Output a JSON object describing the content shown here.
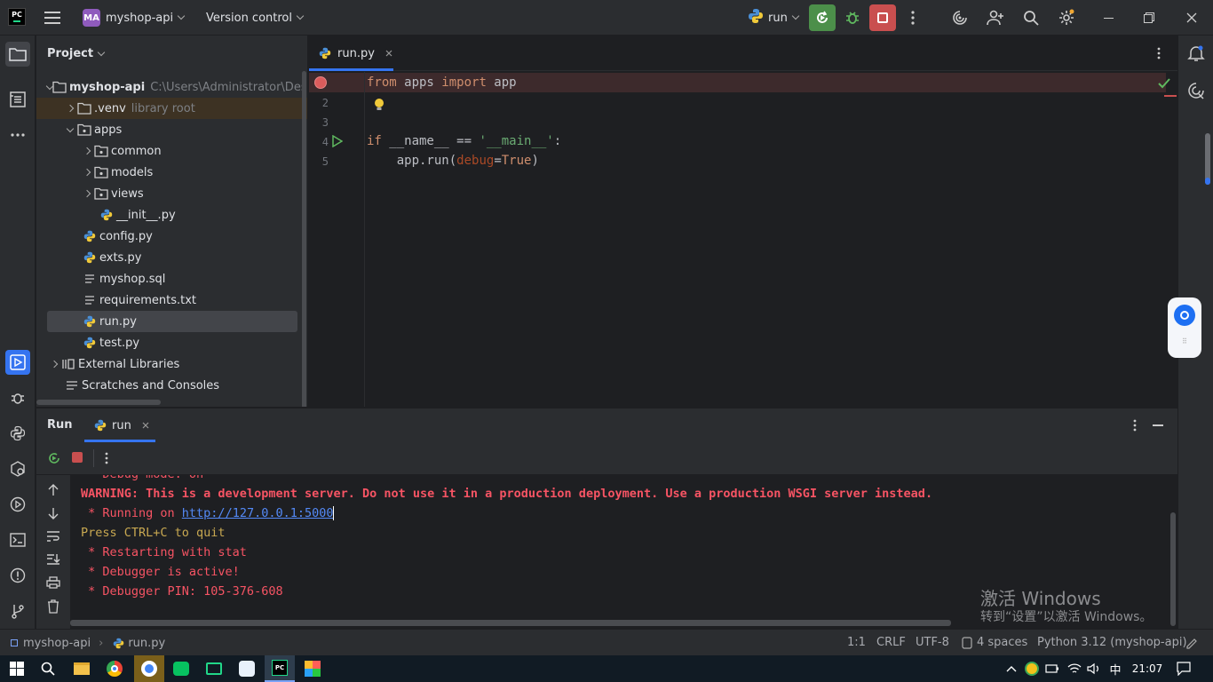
{
  "titlebar": {
    "project_badge": "MA",
    "project_name": "myshop-api",
    "vcs_label": "Version control",
    "run_config": "run"
  },
  "project_panel": {
    "title": "Project",
    "tree": [
      {
        "label": "myshop-api",
        "extra": "C:\\Users\\Administrator\\Deskto"
      },
      {
        "label": ".venv",
        "extra": "library root"
      },
      {
        "label": "apps"
      },
      {
        "label": "common"
      },
      {
        "label": "models"
      },
      {
        "label": "views"
      },
      {
        "label": "__init__.py"
      },
      {
        "label": "config.py"
      },
      {
        "label": "exts.py"
      },
      {
        "label": "myshop.sql"
      },
      {
        "label": "requirements.txt"
      },
      {
        "label": "run.py"
      },
      {
        "label": "test.py"
      },
      {
        "label": "External Libraries"
      },
      {
        "label": "Scratches and Consoles"
      }
    ]
  },
  "editor": {
    "tab_label": "run.py",
    "line_numbers": [
      "2",
      "3",
      "4",
      "5"
    ],
    "code": {
      "l1_kw1": "from",
      "l1_mod": " apps ",
      "l1_kw2": "import",
      "l1_name": " app",
      "l4_kw": "if",
      "l4_mid": " __name__ == ",
      "l4_str": "'__main__'",
      "l4_end": ":",
      "l5_start": "    app.run(",
      "l5_param": "debug",
      "l5_eq": "=",
      "l5_true": "True",
      "l5_end": ")"
    }
  },
  "run_panel": {
    "title": "Run",
    "tab_label": "run",
    "lines": {
      "debug_mode": " * Debug mode: on",
      "warning": "WARNING: This is a development server. Do not use it in a production deployment. Use a production WSGI server instead.",
      "running_prefix": " * Running on ",
      "running_url": "http://127.0.0.1:5000",
      "quit": "Press CTRL+C to quit",
      "restarting": " * Restarting with stat",
      "debugger_active": " * Debugger is active!",
      "debugger_pin": " * Debugger PIN: 105-376-608"
    }
  },
  "statusbar": {
    "crumb_project": "myshop-api",
    "crumb_file": "run.py",
    "position": "1:1",
    "line_sep": "CRLF",
    "encoding": "UTF-8",
    "indent": "4 spaces",
    "interpreter": "Python 3.12 (myshop-api)"
  },
  "watermark": {
    "line1": "激活 Windows",
    "line2": "转到“设置”以激活 Windows。"
  },
  "taskbar": {
    "ime": "中",
    "clock": "21:07"
  },
  "colors": {
    "accent": "#3574f0",
    "run_green": "#4c8f4a",
    "stop_red": "#c94f4f",
    "error_red": "#f75464"
  }
}
